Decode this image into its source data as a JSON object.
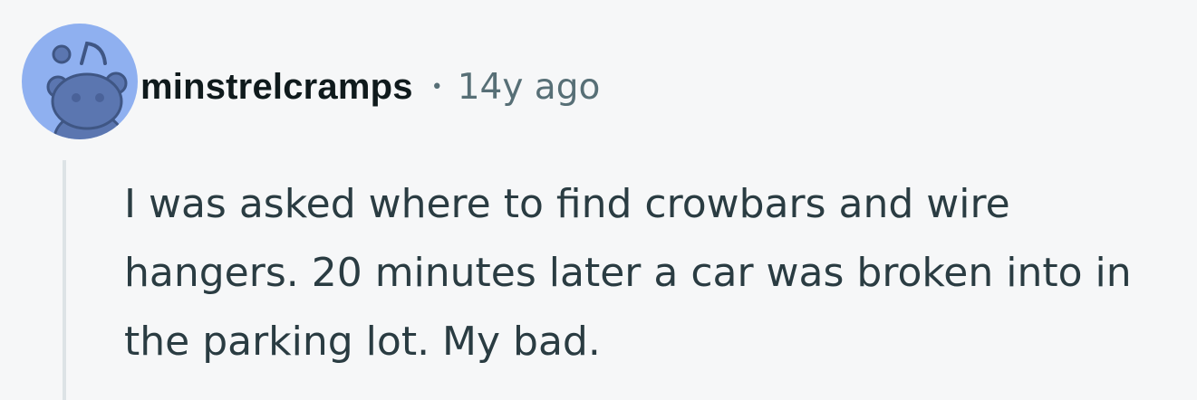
{
  "comment": {
    "author": "minstrelcramps",
    "separator": "•",
    "timestamp": "14y ago",
    "body": "I was asked where to find crowbars and wire hangers. 20 minutes later a car was broken into in the parking lot. My bad."
  },
  "avatar": {
    "icon": "reddit-snoo-icon",
    "background_color": "#8fb0f0",
    "figure_color": "#5b76b0"
  },
  "colors": {
    "page_background": "#f6f7f8",
    "author_text": "#0f1a1c",
    "meta_text": "#576f76",
    "body_text": "#2a3c42",
    "thread_line": "#dde3e6"
  }
}
